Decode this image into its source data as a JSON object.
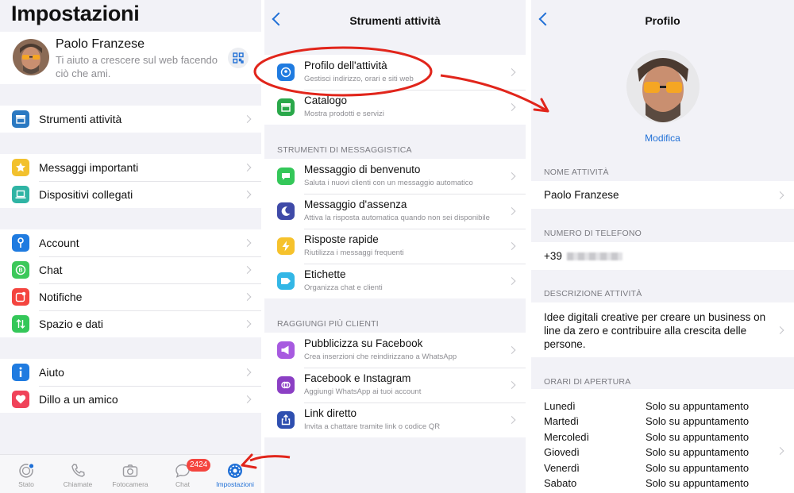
{
  "settings": {
    "title": "Impostazioni",
    "profile": {
      "name": "Paolo Franzese",
      "status": "Ti aiuto a crescere sul web facendo ciò che ami."
    },
    "groups": [
      [
        {
          "label": "Strumenti attività",
          "icon": "store-icon",
          "color": "#2b79c2"
        }
      ],
      [
        {
          "label": "Messaggi importanti",
          "icon": "star-icon",
          "color": "#f2c12e"
        },
        {
          "label": "Dispositivi collegati",
          "icon": "laptop-icon",
          "color": "#2fb4a4"
        }
      ],
      [
        {
          "label": "Account",
          "icon": "key-icon",
          "color": "#1f7be0"
        },
        {
          "label": "Chat",
          "icon": "whatsapp-business-icon",
          "color": "#3cc85a"
        },
        {
          "label": "Notifiche",
          "icon": "notification-icon",
          "color": "#f4453f"
        },
        {
          "label": "Spazio e dati",
          "icon": "data-arrows-icon",
          "color": "#34c759"
        }
      ],
      [
        {
          "label": "Aiuto",
          "icon": "info-icon",
          "color": "#1f7be0"
        },
        {
          "label": "Dillo a un amico",
          "icon": "heart-icon",
          "color": "#f0435a"
        }
      ]
    ],
    "tabs": [
      {
        "label": "Stato",
        "icon": "status-icon"
      },
      {
        "label": "Chiamate",
        "icon": "phone-icon"
      },
      {
        "label": "Fotocamera",
        "icon": "camera-icon"
      },
      {
        "label": "Chat",
        "icon": "chat-icon",
        "badge": "2424"
      },
      {
        "label": "Impostazioni",
        "icon": "settings-icon",
        "active": true
      }
    ]
  },
  "tools": {
    "title": "Strumenti attività",
    "top": [
      {
        "title": "Profilo dell'attività",
        "subtitle": "Gestisci indirizzo, orari e siti web",
        "icon": "business-profile-icon",
        "color": "#1f7be0"
      },
      {
        "title": "Catalogo",
        "subtitle": "Mostra prodotti e servizi",
        "icon": "catalog-icon",
        "color": "#2aa84a"
      }
    ],
    "messaging_header": "STRUMENTI DI MESSAGGISTICA",
    "messaging": [
      {
        "title": "Messaggio di benvenuto",
        "subtitle": "Saluta i nuovi clienti con un messaggio automatico",
        "icon": "greeting-icon",
        "color": "#34c759"
      },
      {
        "title": "Messaggio d'assenza",
        "subtitle": "Attiva la risposta automatica quando non sei disponibile",
        "icon": "moon-icon",
        "color": "#3f4aa8"
      },
      {
        "title": "Risposte rapide",
        "subtitle": "Riutilizza i messaggi frequenti",
        "icon": "lightning-icon",
        "color": "#f6c22c"
      },
      {
        "title": "Etichette",
        "subtitle": "Organizza chat e clienti",
        "icon": "label-icon",
        "color": "#33b7e6"
      }
    ],
    "reach_header": "RAGGIUNGI PIÙ CLIENTI",
    "reach": [
      {
        "title": "Pubblicizza su Facebook",
        "subtitle": "Crea inserzioni che reindirizzano a WhatsApp",
        "icon": "megaphone-icon",
        "color": "#a75ae0"
      },
      {
        "title": "Facebook e Instagram",
        "subtitle": "Aggiungi WhatsApp ai tuoi account",
        "icon": "link-accounts-icon",
        "color": "#8b3fc4"
      },
      {
        "title": "Link diretto",
        "subtitle": "Invita a chattare tramite link o codice QR",
        "icon": "share-icon",
        "color": "#2f4fb0"
      }
    ]
  },
  "profile": {
    "title": "Profilo",
    "edit": "Modifica",
    "name_header": "NOME ATTIVITÀ",
    "name": "Paolo Franzese",
    "phone_header": "NUMERO DI TELEFONO",
    "phone_prefix": "+39",
    "description_header": "DESCRIZIONE ATTIVITÀ",
    "description": "Idee digitali creative per creare un business on line da zero e contribuire alla crescita delle persone.",
    "hours_header": "ORARI DI APERTURA",
    "hours": [
      {
        "day": "Lunedì",
        "value": "Solo su appuntamento"
      },
      {
        "day": "Martedì",
        "value": "Solo su appuntamento"
      },
      {
        "day": "Mercoledì",
        "value": "Solo su appuntamento"
      },
      {
        "day": "Giovedì",
        "value": "Solo su appuntamento"
      },
      {
        "day": "Venerdì",
        "value": "Solo su appuntamento"
      },
      {
        "day": "Sabato",
        "value": "Solo su appuntamento"
      }
    ]
  }
}
